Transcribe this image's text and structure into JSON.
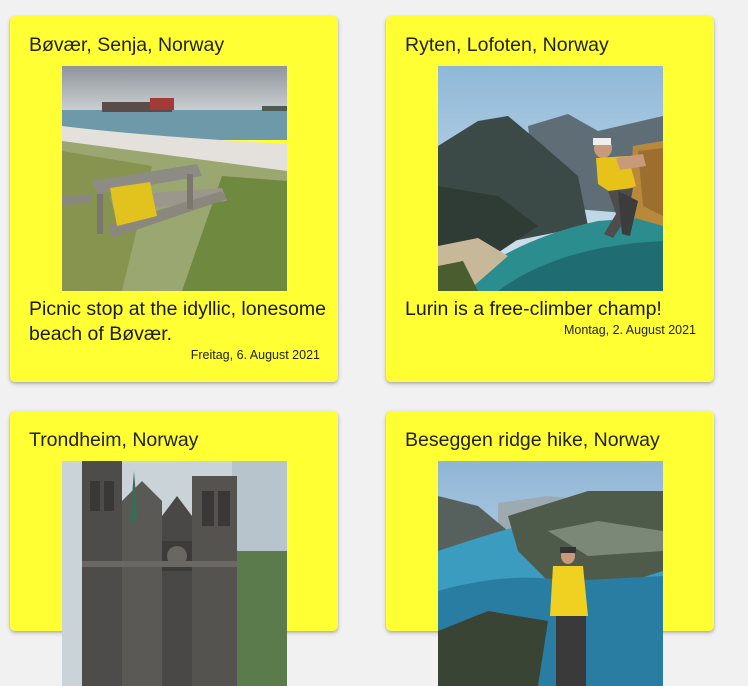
{
  "cards": [
    {
      "title": "Bøvær, Senja, Norway",
      "caption": "Picnic stop at the idyllic, lonesome beach of Bøvær.",
      "date": "Freitag, 6. August 2021",
      "photo_icon": "beach-picnic-table-photo"
    },
    {
      "title": "Ryten, Lofoten, Norway",
      "caption": "Lurin is a free-climber champ!",
      "date": "Montag, 2. August 2021",
      "photo_icon": "mountain-climber-photo"
    },
    {
      "title": "Trondheim, Norway",
      "photo_icon": "cathedral-photo"
    },
    {
      "title": "Beseggen ridge hike, Norway",
      "photo_icon": "ridge-lake-hiker-photo"
    }
  ],
  "colors": {
    "card_background": "#ffff33",
    "page_background": "#f1f1f1"
  }
}
